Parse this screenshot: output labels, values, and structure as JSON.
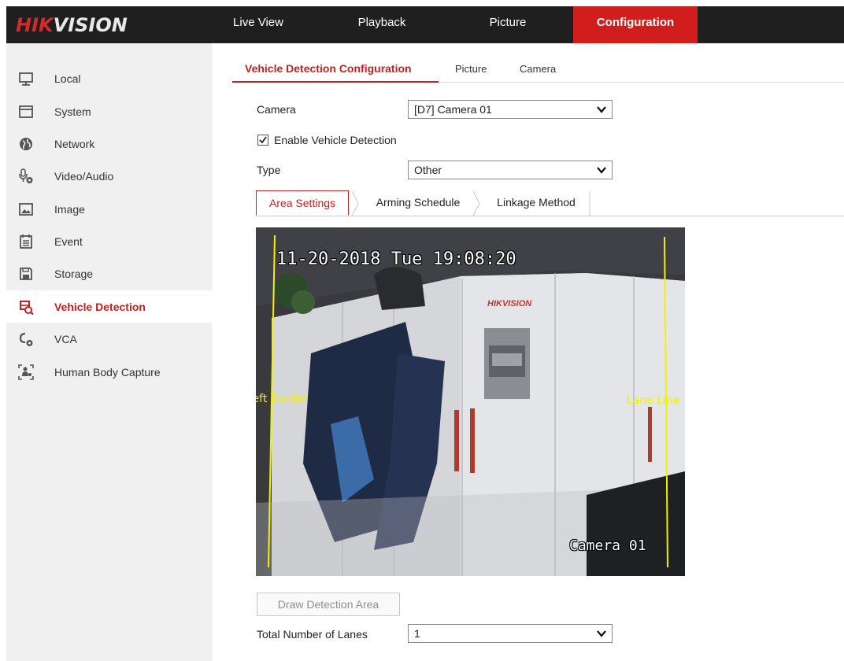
{
  "brand": {
    "part1": "HIK",
    "part2": "VISION"
  },
  "topnav": [
    {
      "label": "Live View"
    },
    {
      "label": "Playback"
    },
    {
      "label": "Picture"
    },
    {
      "label": "Configuration",
      "active": true
    }
  ],
  "sidebar": {
    "items": [
      {
        "label": "Local",
        "icon": "monitor-icon"
      },
      {
        "label": "System",
        "icon": "system-icon"
      },
      {
        "label": "Network",
        "icon": "globe-icon"
      },
      {
        "label": "Video/Audio",
        "icon": "microphone-icon"
      },
      {
        "label": "Image",
        "icon": "image-icon"
      },
      {
        "label": "Event",
        "icon": "calendar-icon"
      },
      {
        "label": "Storage",
        "icon": "storage-icon"
      },
      {
        "label": "Vehicle Detection",
        "icon": "vehicle-detection-icon",
        "active": true
      },
      {
        "label": "VCA",
        "icon": "vca-icon"
      },
      {
        "label": "Human Body Capture",
        "icon": "human-body-capture-icon"
      }
    ]
  },
  "subtabs": [
    {
      "label": "Vehicle Detection Configuration",
      "active": true
    },
    {
      "label": "Picture"
    },
    {
      "label": "Camera"
    }
  ],
  "form": {
    "camera_label": "Camera",
    "camera_value": "[D7] Camera 01",
    "enable_label": "Enable Vehicle Detection",
    "enable_checked": true,
    "type_label": "Type",
    "type_value": "Other"
  },
  "inner_tabs": [
    {
      "label": "Area Settings",
      "active": true
    },
    {
      "label": "Arming Schedule"
    },
    {
      "label": "Linkage Method"
    }
  ],
  "video": {
    "timestamp": "11-20-2018 Tue 19:08:20",
    "camera_name": "Camera 01",
    "left_border_label": "Left Border",
    "lane_line_label": "Lane Line",
    "wall_brand": "HIKVISION"
  },
  "draw_button": "Draw Detection Area",
  "lanes": {
    "label": "Total Number of Lanes",
    "value": "1"
  },
  "colors": {
    "accent": "#d21d1d",
    "topbar": "#1f1f1f",
    "sidebar": "#f0f0f0",
    "lane": "#f2f200"
  }
}
